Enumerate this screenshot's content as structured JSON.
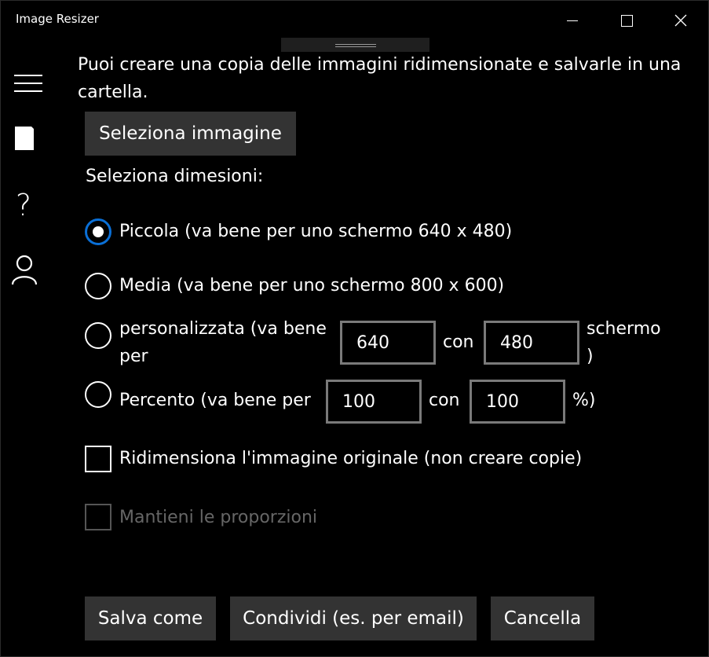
{
  "window": {
    "title": "Image Resizer"
  },
  "nav": {
    "items": [
      {
        "icon": "hamburger-icon"
      },
      {
        "icon": "document-icon"
      },
      {
        "icon": "help-icon",
        "glyph": "?"
      },
      {
        "icon": "person-icon"
      }
    ]
  },
  "main": {
    "intro": "Puoi creare una copia delle immagini ridimensionate e salvarle in una cartella.",
    "select_image_label": "Seleziona immagine",
    "dimensions_label": "Seleziona dimesioni:",
    "options": {
      "small": {
        "label": "Piccola (va bene per uno schermo 640 x 480)",
        "checked": true
      },
      "medium": {
        "label": "Media (va bene per uno schermo 800 x 600)",
        "checked": false
      },
      "custom": {
        "label_line1": "personalizzata (va bene",
        "label_line2": "per",
        "width": "640",
        "con": "con",
        "height": "480",
        "suffix_line1": "schermo",
        "suffix_line2": ")"
      },
      "percent": {
        "label": "Percento (va bene per",
        "width": "100",
        "con": "con",
        "height": "100",
        "suffix": "%)"
      }
    },
    "resize_original_label": "Ridimensiona l'immagine originale (non creare copie)",
    "keep_proportions_label": "Mantieni le proporzioni"
  },
  "footer": {
    "save_as": "Salva come",
    "share": "Condividi (es. per email)",
    "cancel": "Cancella"
  },
  "colors": {
    "accent": "#0a6fd6",
    "button_bg": "#333333",
    "textbox_border": "#7a7a7a"
  }
}
